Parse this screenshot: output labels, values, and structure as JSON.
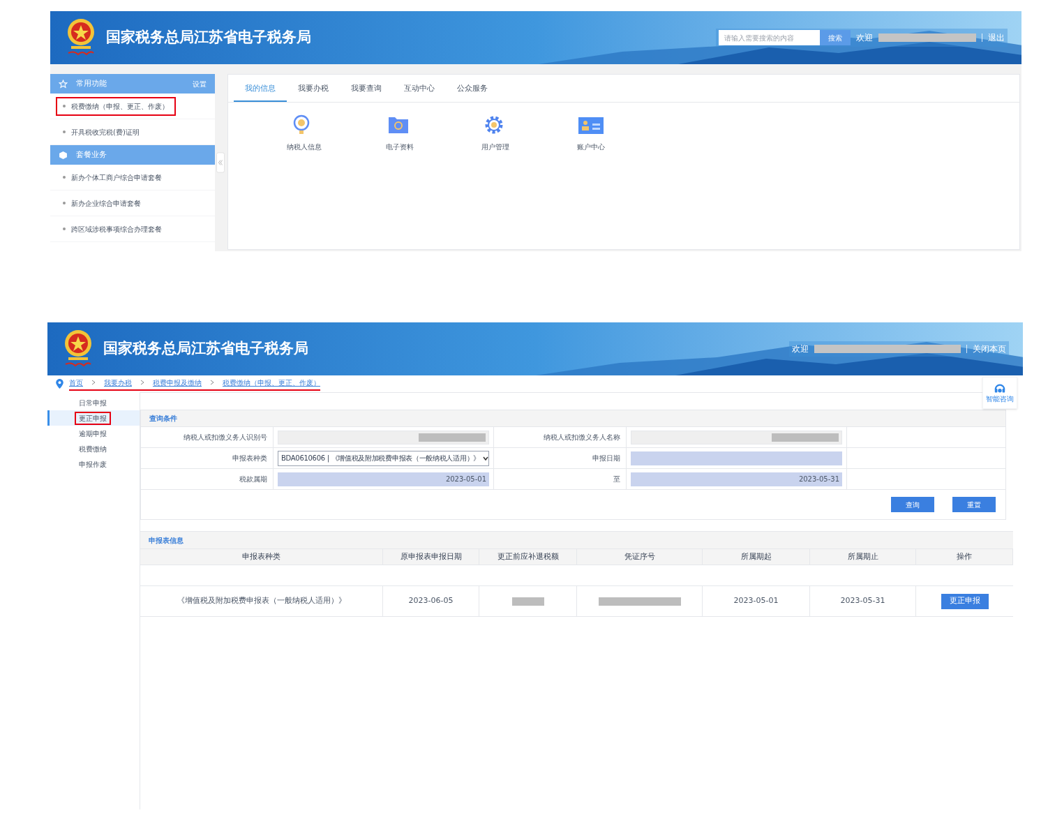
{
  "portal": {
    "header": {
      "title": "国家税务总局江苏省电子税务局",
      "search": {
        "placeholder": "请输入需要搜索的内容",
        "button": "搜索"
      },
      "welcome": "欢迎",
      "user_redacted": true,
      "logout": "退出"
    },
    "sidebar": {
      "sections": [
        {
          "title": "常用功能",
          "action": "设置",
          "items": [
            {
              "label": "税费缴纳（申报、更正、作废）",
              "highlighted": true
            },
            {
              "label": "开具税收完税(费)证明",
              "highlighted": false
            }
          ]
        },
        {
          "title": "套餐业务",
          "items": [
            {
              "label": "新办个体工商户综合申请套餐",
              "highlighted": false
            },
            {
              "label": "新办企业综合申请套餐",
              "highlighted": false
            },
            {
              "label": "跨区域涉税事项综合办理套餐",
              "highlighted": false
            }
          ]
        }
      ]
    },
    "tabs": [
      {
        "label": "我的信息",
        "selected": true
      },
      {
        "label": "我要办税",
        "selected": false
      },
      {
        "label": "我要查询",
        "selected": false
      },
      {
        "label": "互动中心",
        "selected": false
      },
      {
        "label": "公众服务",
        "selected": false
      }
    ],
    "shortcuts": [
      {
        "kind": "person",
        "label": "纳税人信息"
      },
      {
        "kind": "folder",
        "label": "电子资料"
      },
      {
        "kind": "gear",
        "label": "用户管理"
      },
      {
        "kind": "card",
        "label": "账户中心"
      }
    ]
  },
  "declaration": {
    "header": {
      "title": "国家税务总局江苏省电子税务局",
      "welcome": "欢迎",
      "user_redacted": true,
      "close": "关闭本页"
    },
    "breadcrumb": {
      "underlined": true,
      "items": [
        "首页",
        "我要办税",
        "税费申报及缴纳",
        "税费缴纳（申报、更正、作废）"
      ]
    },
    "help": "智能咨询",
    "nav": [
      {
        "label": "日常申报",
        "selected": false,
        "highlighted": false
      },
      {
        "label": "更正申报",
        "selected": true,
        "highlighted": true
      },
      {
        "label": "逾期申报",
        "selected": false,
        "highlighted": false
      },
      {
        "label": "税费缴纳",
        "selected": false,
        "highlighted": false
      },
      {
        "label": "申报作废",
        "selected": false,
        "highlighted": false
      }
    ],
    "query": {
      "title": "查询条件",
      "id_label": "纳税人或扣缴义务人识别号",
      "id_redacted": true,
      "name_label": "纳税人或扣缴义务人名称",
      "name_redacted": true,
      "form_label": "申报表种类",
      "form_value": "BDA0610606 | 《增值税及附加税费申报表（一般纳税人适用）》",
      "date_label": "申报日期",
      "period_label": "税款属期",
      "period_start": "2023-05-01",
      "to_label": "至",
      "period_end": "2023-05-31",
      "buttons": [
        "查询",
        "重置"
      ]
    },
    "results": {
      "title": "申报表信息",
      "columns": [
        "申报表种类",
        "原申报表申报日期",
        "更正前应补退税额",
        "凭证序号",
        "所属期起",
        "所属期止",
        "操作"
      ],
      "rows": [
        {
          "form": "《增值税及附加税费申报表（一般纳税人适用）》",
          "date": "2023-06-05",
          "amount_redacted": true,
          "voucher_redacted": true,
          "start": "2023-05-01",
          "end": "2023-05-31",
          "action": "更正申报"
        }
      ]
    }
  }
}
